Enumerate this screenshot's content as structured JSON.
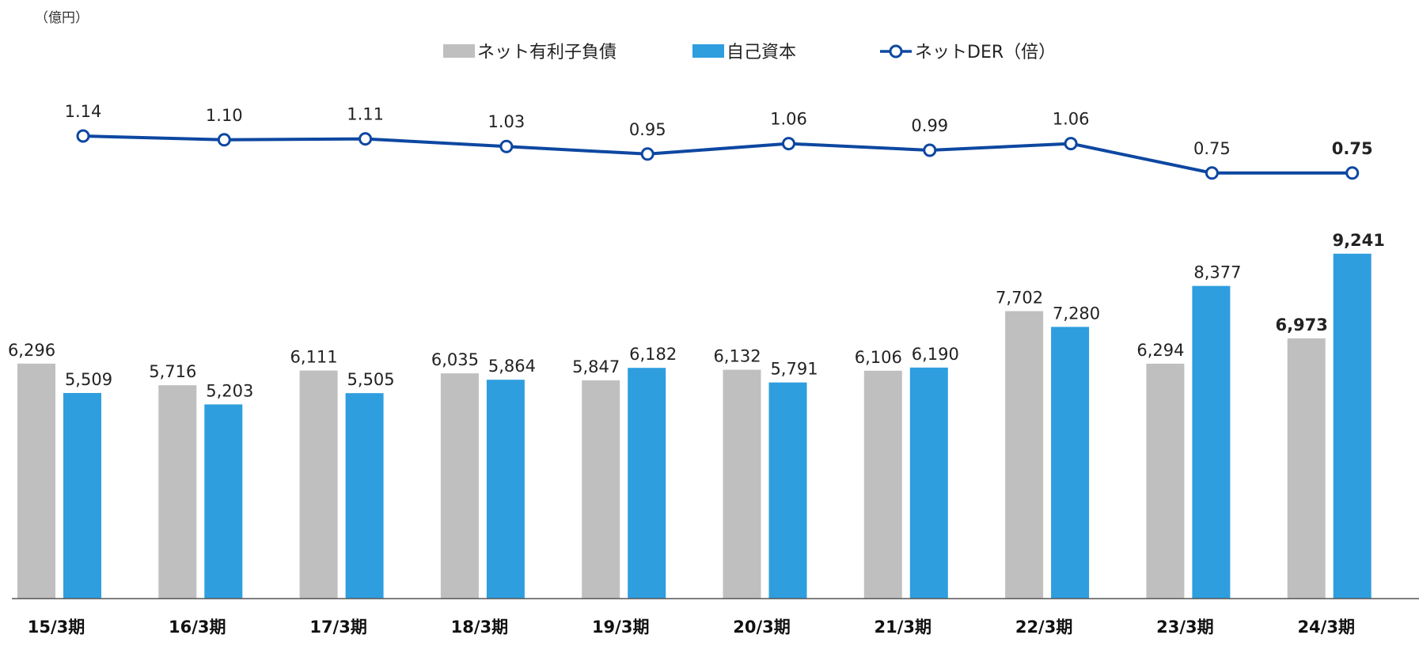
{
  "chart_data": {
    "type": "bar",
    "unit_label": "（億円）",
    "categories": [
      "15/3期",
      "16/3期",
      "17/3期",
      "18/3期",
      "19/3期",
      "20/3期",
      "21/3期",
      "22/3期",
      "23/3期",
      "24/3期"
    ],
    "series": [
      {
        "name": "ネット有利子負債",
        "type": "bar",
        "color": "#bfbfbf",
        "values": [
          6296,
          5716,
          6111,
          6035,
          5847,
          6132,
          6106,
          7702,
          6294,
          6973
        ],
        "labels": [
          "6,296",
          "5,716",
          "6,111",
          "6,035",
          "5,847",
          "6,132",
          "6,106",
          "7,702",
          "6,294",
          "6,973"
        ]
      },
      {
        "name": "自己資本",
        "type": "bar",
        "color": "#2e9ede",
        "values": [
          5509,
          5203,
          5505,
          5864,
          6182,
          5791,
          6190,
          7280,
          8377,
          9241
        ],
        "labels": [
          "5,509",
          "5,203",
          "5,505",
          "5,864",
          "6,182",
          "5,791",
          "6,190",
          "7,280",
          "8,377",
          "9,241"
        ]
      },
      {
        "name": "ネットDER（倍）",
        "type": "line",
        "color": "#0d47a1",
        "values": [
          1.14,
          1.1,
          1.11,
          1.03,
          0.95,
          1.06,
          0.99,
          1.06,
          0.75,
          0.75
        ],
        "labels": [
          "1.14",
          "1.10",
          "1.11",
          "1.03",
          "0.95",
          "1.06",
          "0.99",
          "1.06",
          "0.75",
          "0.75"
        ]
      }
    ],
    "bold_last_category": true,
    "legend_position": "top-center",
    "grid": false
  }
}
